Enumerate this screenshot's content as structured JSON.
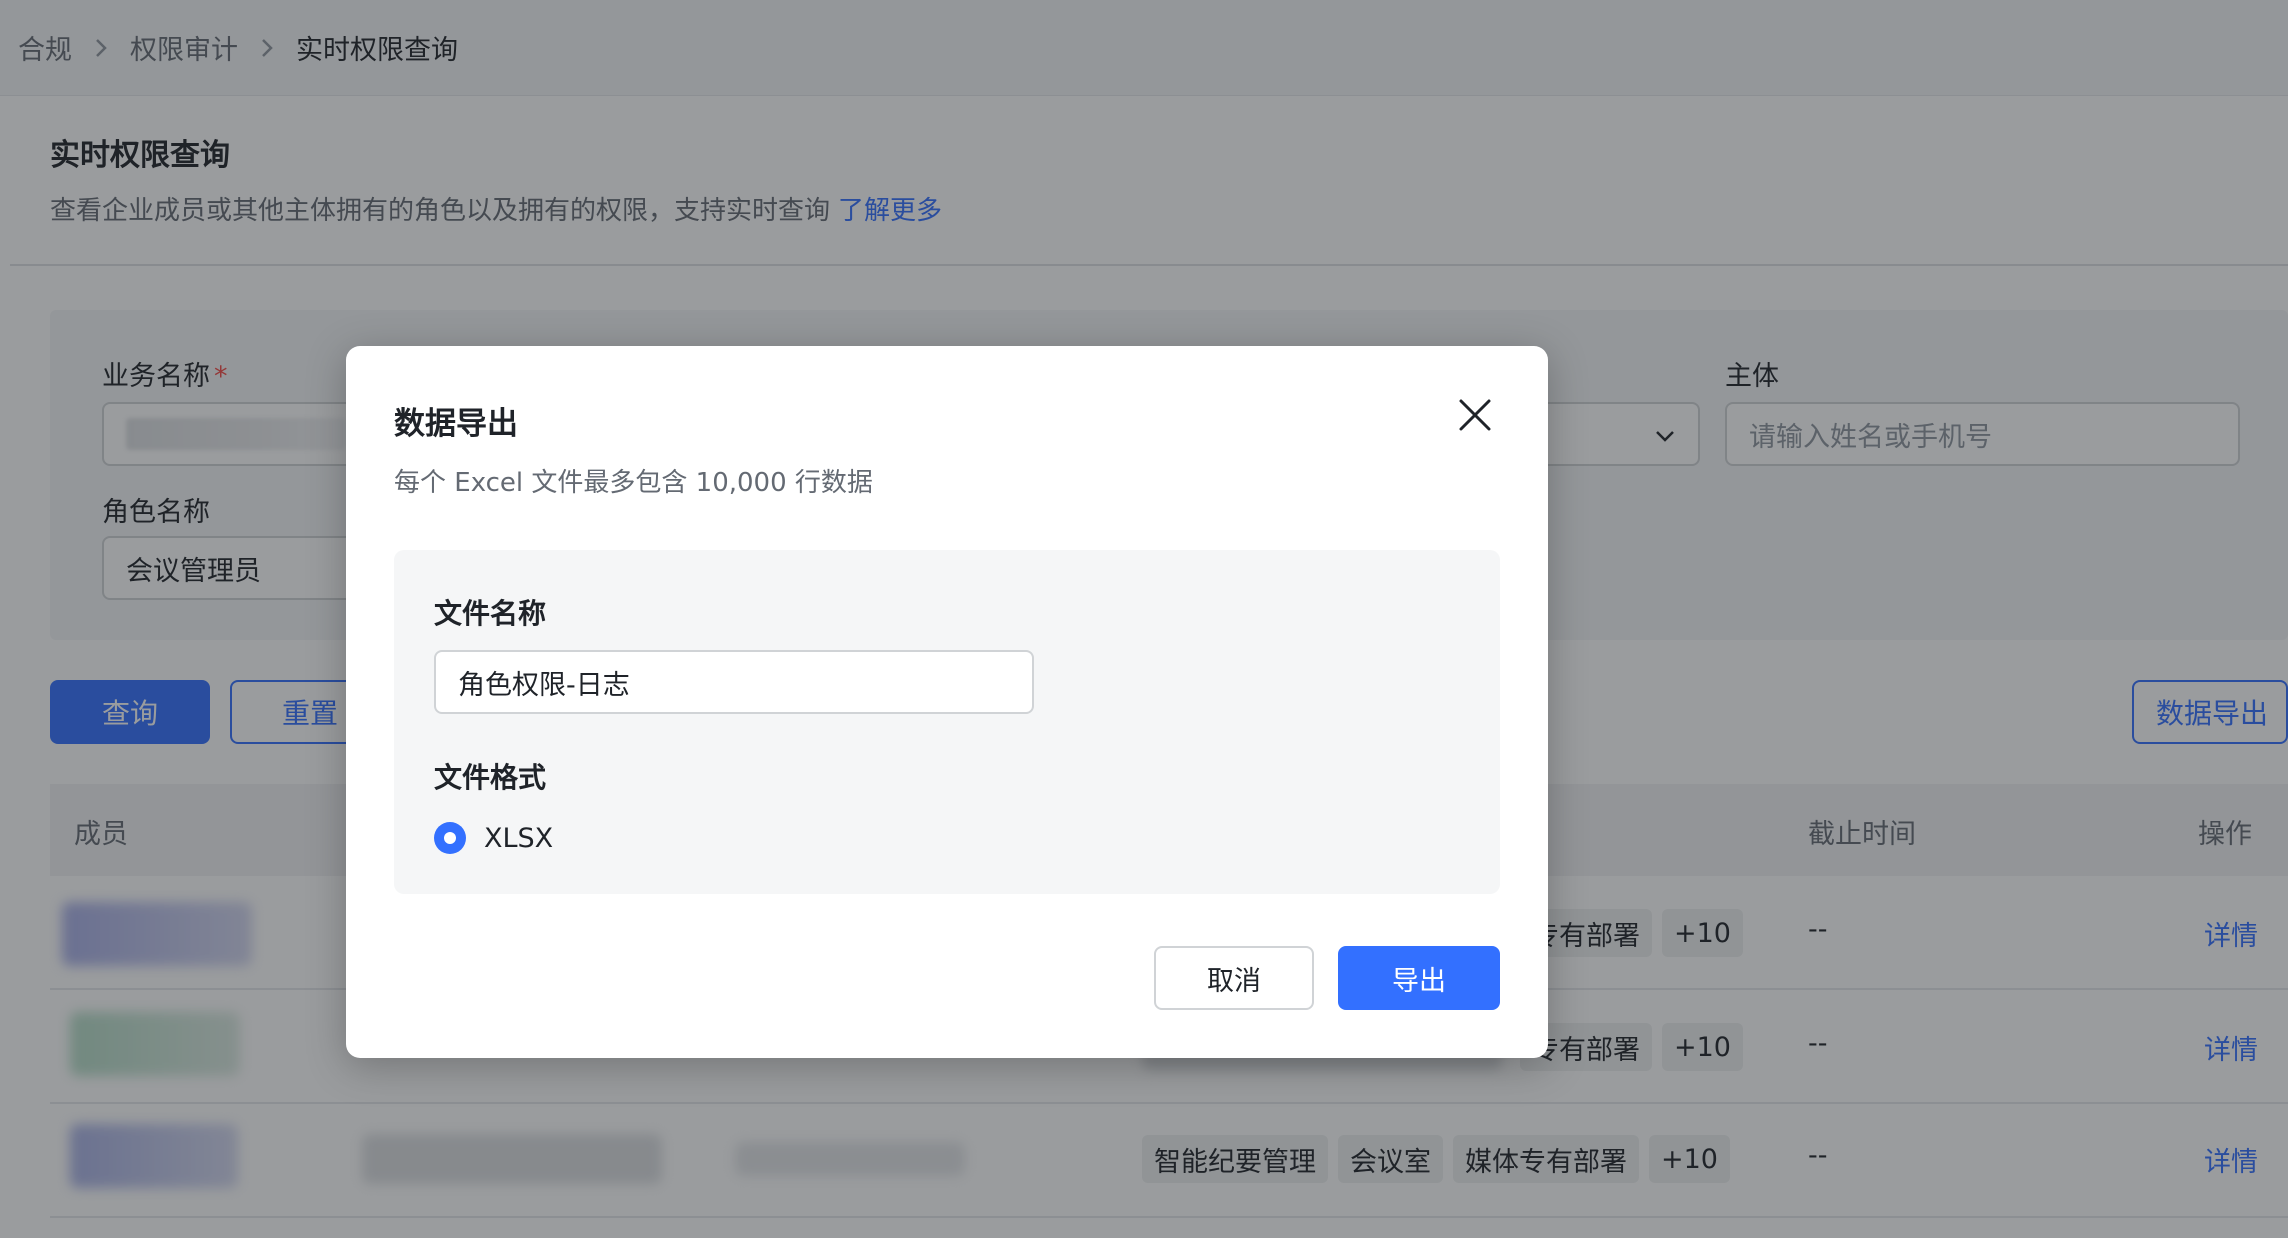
{
  "breadcrumb": [
    "合规",
    "权限审计",
    "实时权限查询"
  ],
  "page": {
    "title": "实时权限查询",
    "description": "查看企业成员或其他主体拥有的角色以及拥有的权限，支持实时查询",
    "learn_more": "了解更多"
  },
  "filters": {
    "business_label": "业务名称",
    "required_mark": "*",
    "subject_label": "主体",
    "subject_placeholder": "请输入姓名或手机号",
    "role_label": "角色名称",
    "role_value": "会议管理员"
  },
  "actions": {
    "query": "查询",
    "reset": "重置",
    "export": "数据导出"
  },
  "table": {
    "headers": {
      "member": "成员",
      "deadline": "截止时间",
      "operation": "操作"
    },
    "rows": [
      {
        "tags": [
          "专有部署"
        ],
        "more": "+10",
        "deadline": "--",
        "action": "详情"
      },
      {
        "tags": [
          "专有部署"
        ],
        "more": "+10",
        "deadline": "--",
        "action": "详情"
      },
      {
        "tags": [
          "智能纪要管理",
          "会议室",
          "媒体专有部署"
        ],
        "more": "+10",
        "deadline": "--",
        "action": "详情"
      }
    ]
  },
  "modal": {
    "title": "数据导出",
    "subtitle": "每个 Excel 文件最多包含 10,000 行数据",
    "filename_label": "文件名称",
    "filename_value": "角色权限-日志",
    "format_label": "文件格式",
    "format_option": "XLSX",
    "format_selected": true,
    "cancel": "取消",
    "confirm": "导出"
  },
  "colors": {
    "accent": "#3370ff",
    "overlay": "rgba(31,35,41,0.45)"
  },
  "icons": [
    "chevron-right-icon",
    "chevron-down-icon",
    "close-icon"
  ]
}
